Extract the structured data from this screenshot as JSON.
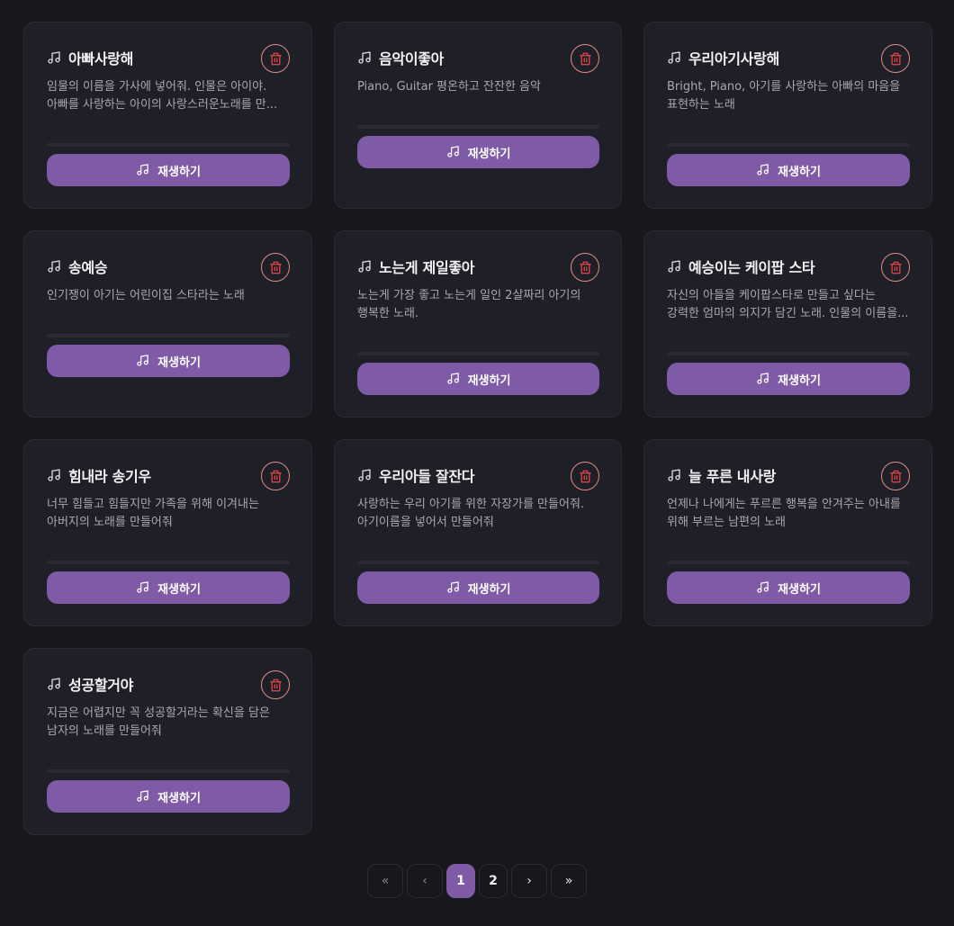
{
  "songs": [
    {
      "title": "아빠사랑해",
      "description": "임물의 이름을 가사에 넣어줘. 인물은 아이야. 아빠를 사랑하는 아이의 사랑스러운노래를 만...",
      "play_label": "재생하기"
    },
    {
      "title": "음악이좋아",
      "description": "Piano, Guitar 평온하고 잔잔한 음악",
      "play_label": "재생하기"
    },
    {
      "title": "우리아기사랑해",
      "description": "Bright, Piano, 아기를 사랑하는 아빠의 마음을 표현하는 노래",
      "play_label": "재생하기"
    },
    {
      "title": "송예승",
      "description": "인기쟁이 아기는 어린이집 스타라는 노래",
      "play_label": "재생하기"
    },
    {
      "title": "노는게 제일좋아",
      "description": "노는게 가장 좋고 노는게 일인 2살짜리 아기의 행복한 노래.",
      "play_label": "재생하기"
    },
    {
      "title": "예승이는 케이팝 스타",
      "description": "자신의 아들을 케이팝스타로 만들고 싶다는 강력한 엄마의 의지가 담긴 노래. 인물의 이름을...",
      "play_label": "재생하기"
    },
    {
      "title": "힘내라 송기우",
      "description": "너무 힘들고 힘들지만 가족을 위해 이겨내는 아버지의 노래를 만들어줘",
      "play_label": "재생하기"
    },
    {
      "title": "우리아들 잘잔다",
      "description": "사랑하는 우리 아기를 위한 자장가를 만들어줘. 아기이름을 넣어서 만들어줘",
      "play_label": "재생하기"
    },
    {
      "title": "늘 푸른 내사랑",
      "description": "언제나 나에게는 푸르른 행복을 안겨주는 아내를 위해 부르는 남편의 노래",
      "play_label": "재생하기"
    },
    {
      "title": "성공할거야",
      "description": "지금은 어렵지만 꼭 성공할거라는 확신을 담은 남자의 노래를 만들어줘",
      "play_label": "재생하기"
    }
  ],
  "icons": {
    "song": "music-note-icon",
    "delete": "trash-icon",
    "play": "music-note-icon"
  },
  "pagination": {
    "first": "«",
    "prev": "‹",
    "pages": [
      "1",
      "2"
    ],
    "current": "1",
    "next": "›",
    "last": "»"
  },
  "colors": {
    "background": "#17171c",
    "card": "#1f1f27",
    "accent": "#7f5aa6",
    "delete": "#e5484d"
  }
}
